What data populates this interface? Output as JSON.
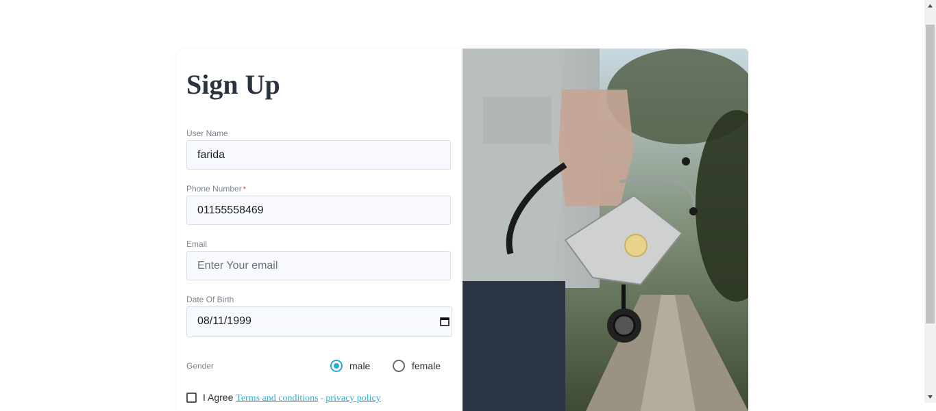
{
  "form": {
    "title": "Sign Up",
    "username": {
      "label": "User Name",
      "value": "farida"
    },
    "phone": {
      "label": "Phone Number",
      "required_mark": "*",
      "value": "01155558469"
    },
    "email": {
      "label": "Email",
      "placeholder": "Enter Your email",
      "value": ""
    },
    "dob": {
      "label": "Date Of Birth",
      "value": "08/11/1999"
    },
    "gender": {
      "label": "Gender",
      "options": [
        "male",
        "female"
      ],
      "selected": "male"
    },
    "agree": {
      "text": "I Agree",
      "terms_link": "Terms and conditions",
      "separator": "-",
      "privacy_link": "privacy policy",
      "checked": false
    }
  },
  "colors": {
    "accent": "#29a8d6",
    "title": "#2b3340",
    "link": "#2ab0d4",
    "field_bg": "#f7f9fe"
  },
  "image": {
    "subject": "doctor-holding-stethoscope-and-mask"
  }
}
